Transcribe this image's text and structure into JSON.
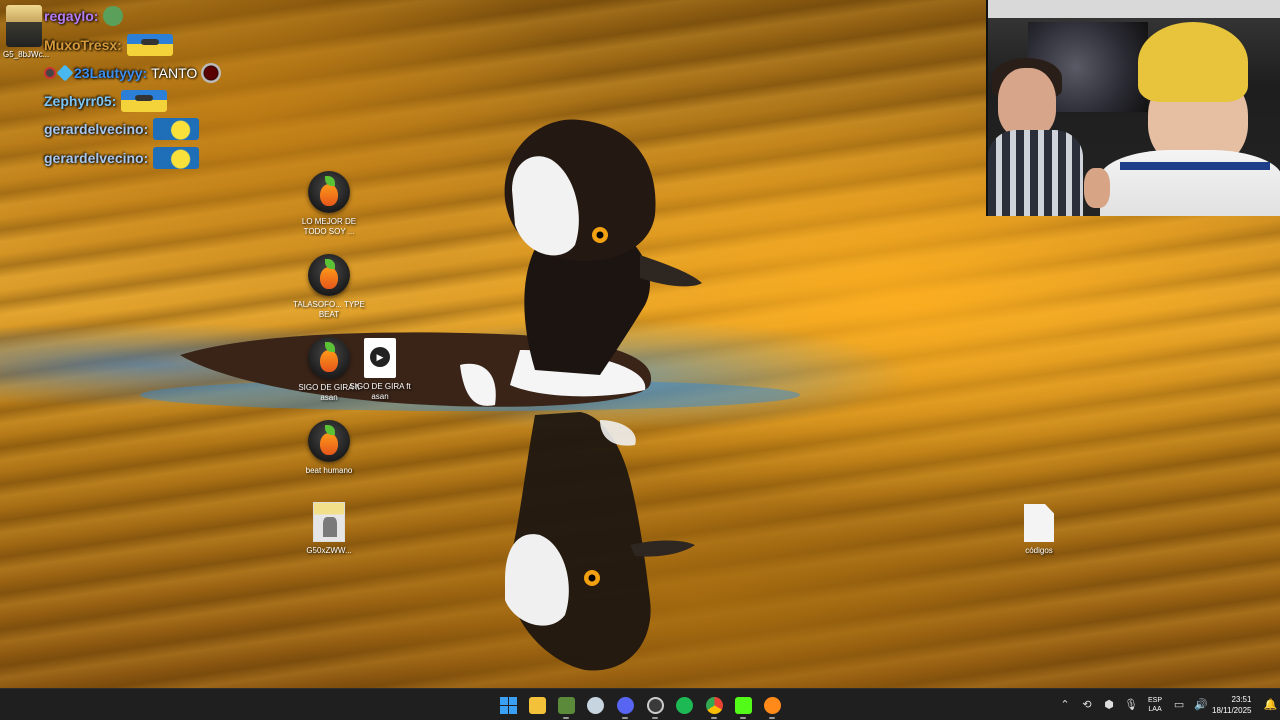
{
  "chat": {
    "avatar_caption": "G5_8bJWc...",
    "lines": [
      {
        "user": "regaylo:",
        "user_color": "#b57cf5",
        "message": ""
      },
      {
        "user": "MuxoTresx:",
        "user_color": "#d79a3a",
        "message": ""
      },
      {
        "user": "23Lautyyy:",
        "user_color": "#3a8ef0",
        "message": "TANTO"
      },
      {
        "user": "Zephyrr05:",
        "user_color": "#7cc5f5",
        "message": ""
      },
      {
        "user": "gerardelvecino:",
        "user_color": "#a8c8f0",
        "message": ""
      },
      {
        "user": "gerardelvecino:",
        "user_color": "#a8c8f0",
        "message": ""
      }
    ]
  },
  "desktop": {
    "icons": [
      {
        "label": "LO MEJOR DE TODO SOY ...",
        "type": "fl-studio-icon"
      },
      {
        "label": "TALASOFO... TYPE BEAT",
        "type": "fl-studio-icon"
      },
      {
        "label": "SIGO DE GIRA ft asan",
        "type": "fl-studio-icon"
      },
      {
        "label": "SIGO DE GIRA ft asan",
        "type": "media-file-icon"
      },
      {
        "label": "beat humano",
        "type": "fl-studio-icon"
      },
      {
        "label": "G50xZWW...",
        "type": "image-file-icon"
      },
      {
        "label": "códigos",
        "type": "text-file-icon"
      }
    ]
  },
  "taskbar": {
    "apps": [
      {
        "name": "start-button",
        "color": "#3aa0f3"
      },
      {
        "name": "file-explorer-icon",
        "color": "#f3c23a"
      },
      {
        "name": "minecraft-launcher-icon",
        "color": "#5a8a3a"
      },
      {
        "name": "steam-icon",
        "color": "#c7d5e0"
      },
      {
        "name": "discord-icon",
        "color": "#5865f2"
      },
      {
        "name": "obs-icon",
        "color": "#3a3a3a"
      },
      {
        "name": "spotify-icon",
        "color": "#1db954"
      },
      {
        "name": "chrome-icon",
        "color": "#4285f4"
      },
      {
        "name": "kick-icon",
        "color": "#53fc18"
      },
      {
        "name": "fl-studio-icon",
        "color": "#ff8a1a"
      }
    ],
    "tray": {
      "language_top": "ESP",
      "language_bottom": "LAA",
      "time": "23:51",
      "date": "18/11/2025"
    }
  }
}
